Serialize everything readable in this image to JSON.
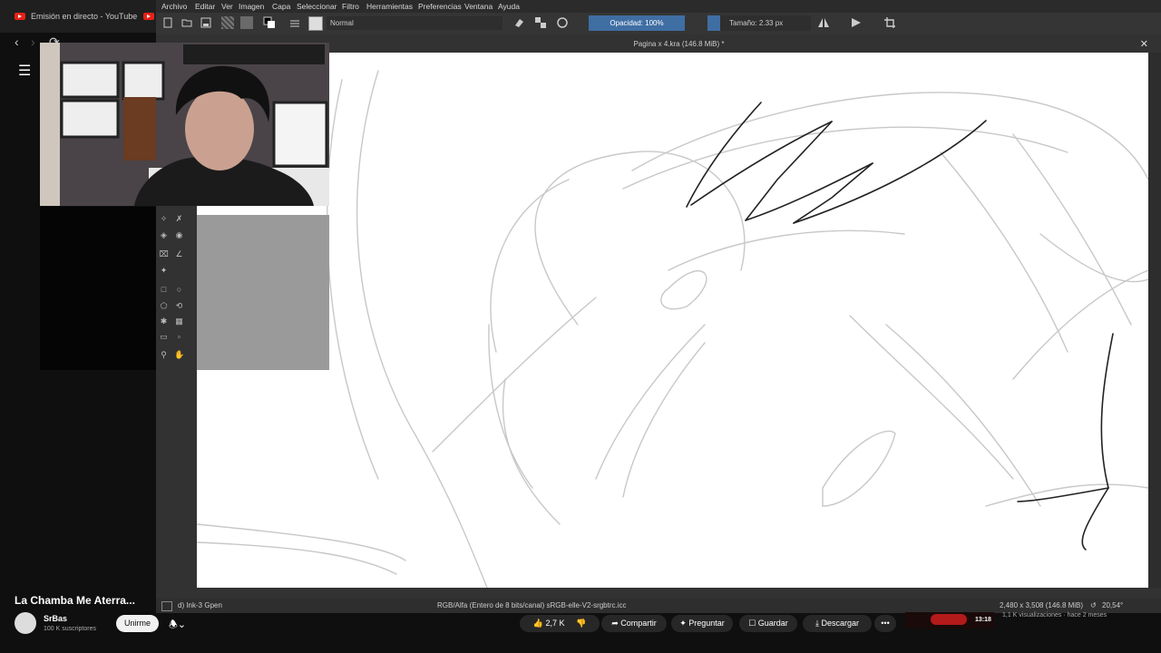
{
  "browser": {
    "tab1_title": "Emisión en directo - YouTube",
    "tab2_title": "Y"
  },
  "krita": {
    "menu": [
      "Archivo",
      "Editar",
      "Ver",
      "Imagen",
      "Capa",
      "Seleccionar",
      "Filtro",
      "Herramientas",
      "Preferencias",
      "Ventana",
      "Ayuda"
    ],
    "blend_mode": "Normal",
    "opacity_label": "Opacidad: 100%",
    "size_label": "Tamaño: 2.33 px",
    "doc_title": "Pagina x 4.kra (146.8 MiB) *",
    "status_brush": "d) Ink-3 Gpen",
    "status_color": "RGB/Alfa (Entero de 8 bits/canal)  sRGB-elle-V2-srgbtrc.icc",
    "status_size": "2,480 x 3,508 (146.8 MiB)",
    "status_rotation": "20,54°"
  },
  "youtube": {
    "video_title": "La Chamba Me Aterra...",
    "channel_name": "SrBas",
    "subscribers": "100 K suscriptores",
    "join_label": "Unirme",
    "likes": "2,7 K",
    "share_label": "Compartir",
    "ask_label": "Preguntar",
    "save_label": "Guardar",
    "download_label": "Descargar",
    "more_label": "•••",
    "side_duration": "13:18",
    "side_views": "1,1 K visualizaciones · hace 2 meses"
  }
}
